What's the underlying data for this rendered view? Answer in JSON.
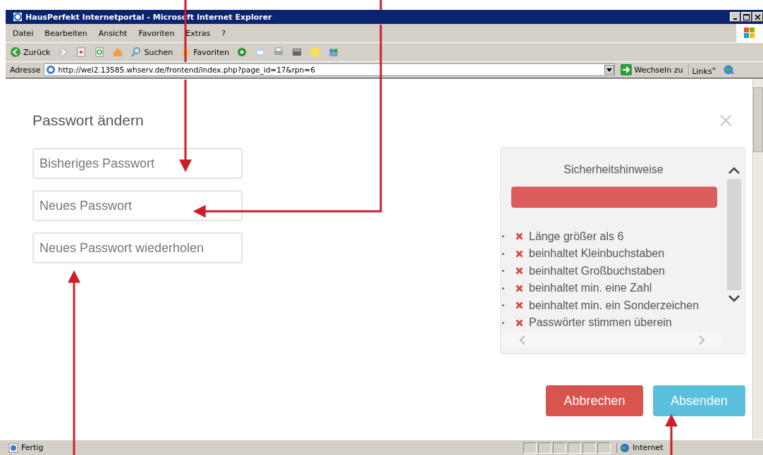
{
  "window": {
    "title": "HausPerfekt Internetportal - Microsoft Internet Explorer"
  },
  "menu": [
    {
      "label": "Datei"
    },
    {
      "label": "Bearbeiten"
    },
    {
      "label": "Ansicht"
    },
    {
      "label": "Favoriten"
    },
    {
      "label": "Extras"
    },
    {
      "label": "?"
    }
  ],
  "toolbar": [
    {
      "kind": "back",
      "label": "Zurück"
    },
    {
      "kind": "forward"
    },
    {
      "kind": "stop"
    },
    {
      "kind": "refresh"
    },
    {
      "kind": "home"
    },
    {
      "kind": "search",
      "label": "Suchen"
    },
    {
      "kind": "favorites",
      "label": "Favoriten"
    },
    {
      "kind": "media"
    },
    {
      "kind": "mail"
    },
    {
      "kind": "print"
    },
    {
      "kind": "edit"
    },
    {
      "kind": "notes"
    },
    {
      "kind": "messenger"
    }
  ],
  "address": {
    "label": "Adresse",
    "value": "http://wel2.13585.whserv.de/frontend/index.php?page_id=17&rpn=6",
    "go": "Wechseln zu",
    "links": "Links",
    "more": "»"
  },
  "dialog": {
    "title": "Passwort ändern",
    "close": "×",
    "fields": [
      {
        "placeholder": "Bisheriges Passwort"
      },
      {
        "placeholder": "Neues Passwort"
      },
      {
        "placeholder": "Neues Passwort wiederholen"
      }
    ],
    "security": {
      "title": "Sicherheitshinweise",
      "strength": {
        "level": 1,
        "color": "#dd5c5c"
      },
      "rules": [
        {
          "text": "Länge größer als 6",
          "met": false
        },
        {
          "text": "beinhaltet Kleinbuchstaben",
          "met": false
        },
        {
          "text": "beinhaltet Großbuchstaben",
          "met": false
        },
        {
          "text": "beinhaltet min. eine Zahl",
          "met": false
        },
        {
          "text": "beinhaltet min. ein Sonderzeichen",
          "met": false
        },
        {
          "text": "Passwörter stimmen überein",
          "met": false
        }
      ]
    },
    "buttons": [
      {
        "kind": "cancel",
        "label": "Abbrechen"
      },
      {
        "kind": "submit",
        "label": "Absenden"
      }
    ]
  },
  "status_bar": {
    "text": "Fertig",
    "zone": "Internet"
  }
}
